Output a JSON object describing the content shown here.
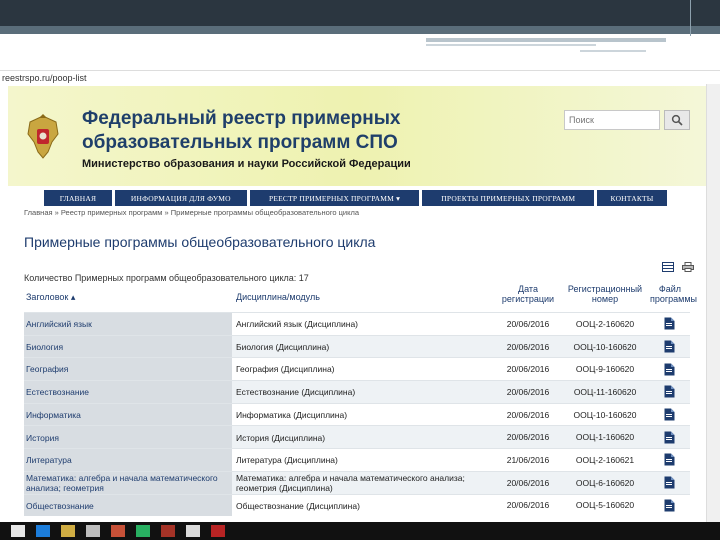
{
  "browser": {
    "url": "reestrspo.ru/poop-list"
  },
  "site": {
    "title_line1": "Федеральный реестр примерных",
    "title_line2": "образовательных программ СПО",
    "subtitle": "Министерство образования и науки Российской Федерации",
    "search_placeholder": "Поиск",
    "search_icon": "search-icon",
    "emblem_icon": "coat-of-arms-icon"
  },
  "nav": {
    "items": [
      {
        "label": "ГЛАВНАЯ"
      },
      {
        "label": "ИНФОРМАЦИЯ ДЛЯ ФУМО"
      },
      {
        "label": "РЕЕСТР ПРИМЕРНЫХ ПРОГРАММ"
      },
      {
        "label": "ПРОЕКТЫ ПРИМЕРНЫХ ПРОГРАММ"
      },
      {
        "label": "КОНТАКТЫ"
      }
    ],
    "dropdown_glyph": "▾"
  },
  "breadcrumb": "Главная » Реестр примерных программ » Примерные программы общеобразовательного цикла",
  "page": {
    "heading": "Примерные программы общеобразовательного цикла",
    "count_text": "Количество Примерных программ общеобразовательного цикла: 17",
    "tool_icons": [
      "table-icon",
      "print-icon"
    ]
  },
  "table": {
    "headers": [
      "Заголовок ▴",
      "Дисциплина/модуль",
      "Дата регистрации",
      "Регистрационный номер",
      "Файл программы"
    ],
    "rows": [
      {
        "title": "Английский язык",
        "discipline": "Английский язык (Дисциплина)",
        "date": "20/06/2016",
        "number": "ООЦ-2-160620",
        "file_icon": "document-icon"
      },
      {
        "title": "Биология",
        "discipline": "Биология (Дисциплина)",
        "date": "20/06/2016",
        "number": "ООЦ-10-160620",
        "file_icon": "document-icon"
      },
      {
        "title": "География",
        "discipline": "География (Дисциплина)",
        "date": "20/06/2016",
        "number": "ООЦ-9-160620",
        "file_icon": "document-icon"
      },
      {
        "title": "Естествознание",
        "discipline": "Естествознание (Дисциплина)",
        "date": "20/06/2016",
        "number": "ООЦ-11-160620",
        "file_icon": "document-icon"
      },
      {
        "title": "Информатика",
        "discipline": "Информатика (Дисциплина)",
        "date": "20/06/2016",
        "number": "ООЦ-10-160620",
        "file_icon": "document-icon"
      },
      {
        "title": "История",
        "discipline": "История (Дисциплина)",
        "date": "20/06/2016",
        "number": "ООЦ-1-160620",
        "file_icon": "document-icon"
      },
      {
        "title": "Литература",
        "discipline": "Литература (Дисциплина)",
        "date": "21/06/2016",
        "number": "ООЦ-2-160621",
        "file_icon": "document-icon"
      },
      {
        "title": "Математика: алгебра и начала математического анализа; геометрия",
        "discipline": "Математика: алгебра и начала математического анализа; геометрия (Дисциплина)",
        "date": "20/06/2016",
        "number": "ООЦ-6-160620",
        "file_icon": "document-icon"
      },
      {
        "title": "Обществознание",
        "discipline": "Обществознание (Дисциплина)",
        "date": "20/06/2016",
        "number": "ООЦ-5-160620",
        "file_icon": "document-icon"
      }
    ]
  },
  "colors": {
    "navy": "#1e3c6e",
    "header_bg": "#eef2b0",
    "title_col_bg": "#d8dde2"
  },
  "taskbar": {
    "icons": [
      "start-icon",
      "edge-icon",
      "folder-icon",
      "store-icon",
      "app-icon",
      "paint-icon",
      "chat-icon",
      "office-icon",
      "pdf-icon"
    ]
  }
}
